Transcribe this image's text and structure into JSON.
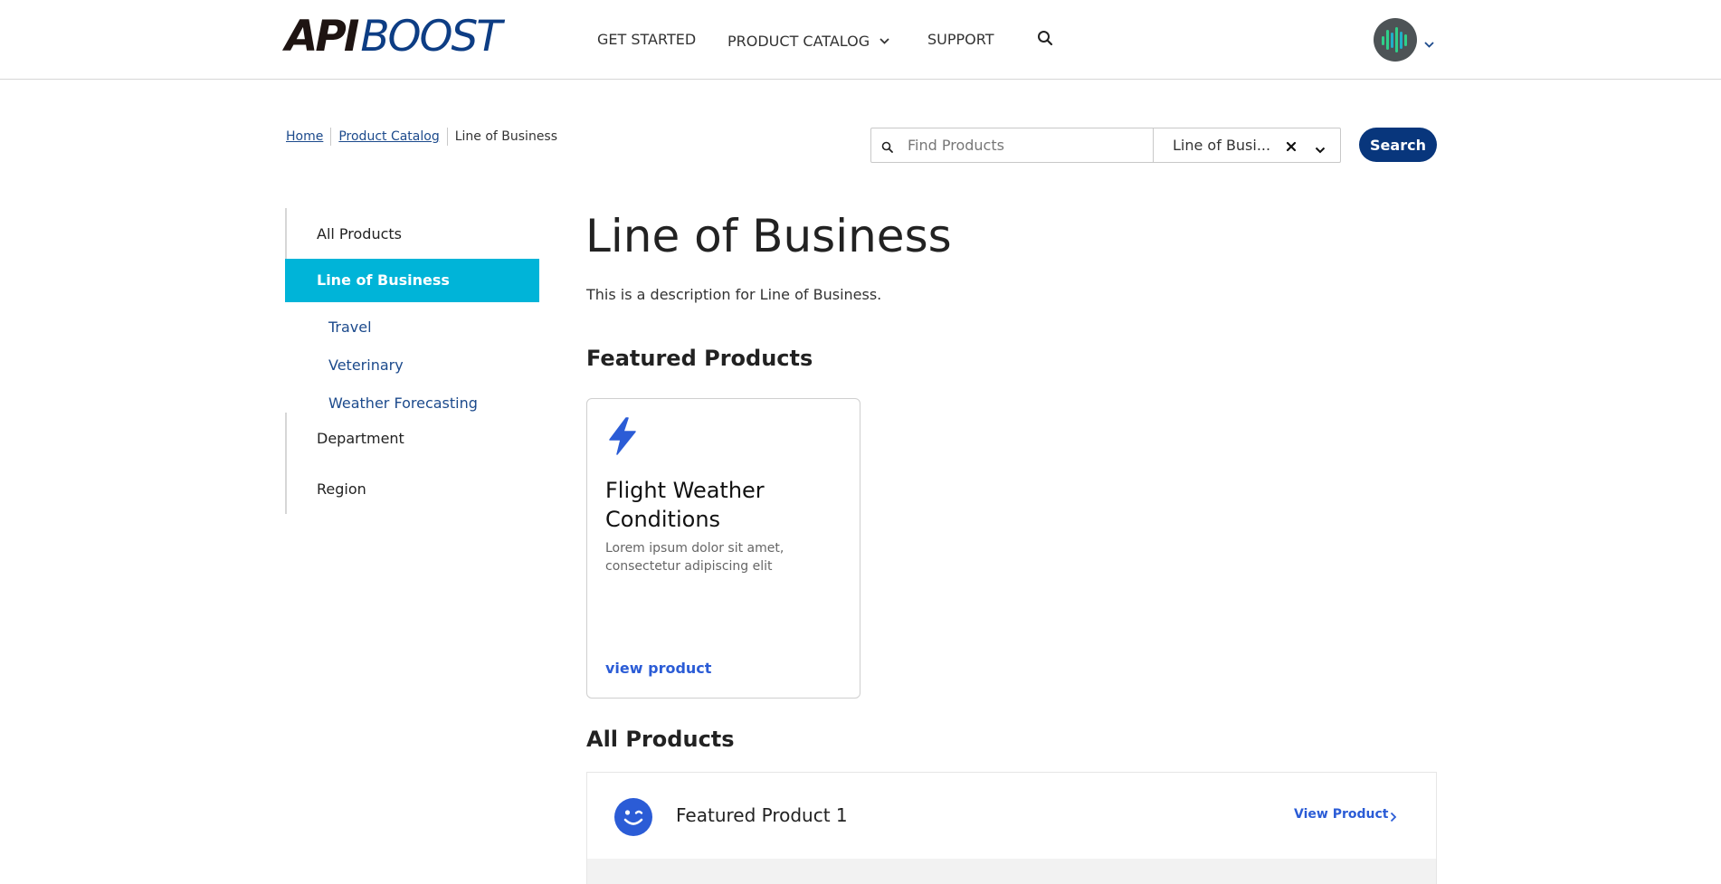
{
  "header": {
    "logo": {
      "part1": "API",
      "part2": "BOOST"
    },
    "nav": [
      {
        "label": "GET STARTED"
      },
      {
        "label": "PRODUCT CATALOG"
      },
      {
        "label": "SUPPORT"
      }
    ],
    "icons": {
      "search": "search-icon",
      "account_menu": "chevron-down-icon"
    }
  },
  "breadcrumb": {
    "items": [
      "Home",
      "Product Catalog"
    ],
    "current": "Line of Business"
  },
  "search": {
    "placeholder": "Find Products",
    "filter_value": "Line of Busi...",
    "button_label": "Search"
  },
  "sidebar": {
    "items": [
      {
        "label": "All Products"
      },
      {
        "label": "Line of Business",
        "active": true
      },
      {
        "label": "Department"
      },
      {
        "label": "Region"
      }
    ],
    "subitems": [
      {
        "label": "Travel"
      },
      {
        "label": "Veterinary"
      },
      {
        "label": "Weather Forecasting"
      }
    ]
  },
  "main": {
    "title": "Line of Business",
    "description": "This is a description for Line of Business.",
    "featured_title": "Featured Products",
    "featured": [
      {
        "icon": "lightning-icon",
        "title": "Flight Weather Conditions",
        "description": "Lorem ipsum dolor sit amet, consectetur adipiscing elit",
        "link": "view product"
      }
    ],
    "all_title": "All Products",
    "products": [
      {
        "icon": "wink-icon",
        "name": "Featured Product 1",
        "link": "View Product"
      }
    ]
  },
  "colors": {
    "brand_dark": "#1e1412",
    "brand_blue": "#0d3d84",
    "accent_cyan": "#00b4d8",
    "link_blue": "#2b5cd6",
    "button_navy": "#08367c"
  }
}
